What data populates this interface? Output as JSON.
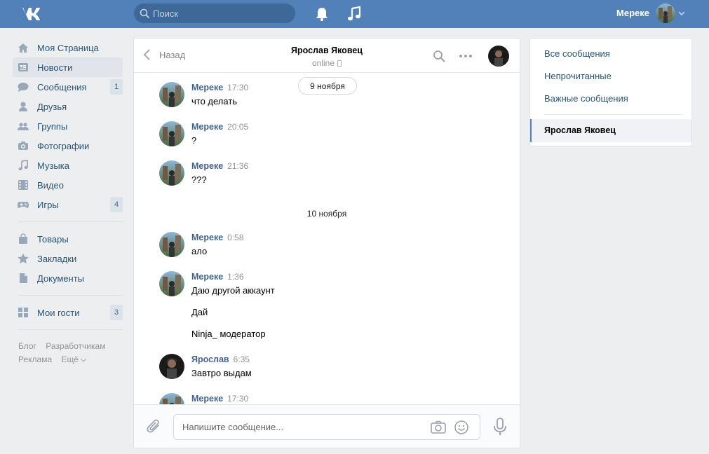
{
  "header": {
    "search_placeholder": "Поиск",
    "user_name": "Мереке"
  },
  "leftnav": {
    "items": [
      {
        "label": "Моя Страница",
        "icon": "home-icon"
      },
      {
        "label": "Новости",
        "icon": "news-icon"
      },
      {
        "label": "Сообщения",
        "icon": "chat-icon",
        "badge": "1"
      },
      {
        "label": "Друзья",
        "icon": "person-icon"
      },
      {
        "label": "Группы",
        "icon": "group-icon"
      },
      {
        "label": "Фотографии",
        "icon": "camera-icon"
      },
      {
        "label": "Музыка",
        "icon": "music-note-icon"
      },
      {
        "label": "Видео",
        "icon": "film-icon"
      },
      {
        "label": "Игры",
        "icon": "gamepad-icon",
        "badge": "4"
      },
      {
        "label": "Товары",
        "icon": "bag-icon"
      },
      {
        "label": "Закладки",
        "icon": "star-icon"
      },
      {
        "label": "Документы",
        "icon": "document-icon"
      },
      {
        "label": "Мои гости",
        "icon": "grid-icon",
        "badge": "3"
      }
    ],
    "footer": {
      "blog": "Блог",
      "developers": "Разработчикам",
      "ads": "Реклама",
      "more": "Ещё"
    }
  },
  "chat": {
    "back_label": "Назад",
    "peer_name": "Ярослав Яковец",
    "peer_status": "online",
    "date_pill": "9 ноября",
    "date_sep": "10 ноября",
    "messages": [
      {
        "author": "Мереке",
        "time": "17:30",
        "lines": [
          "что делать"
        ]
      },
      {
        "author": "Мереке",
        "time": "20:05",
        "lines": [
          "?"
        ]
      },
      {
        "author": "Мереке",
        "time": "21:36",
        "lines": [
          "???"
        ]
      },
      {
        "author": "Мереке",
        "time": "0:58",
        "lines": [
          "ало"
        ]
      },
      {
        "author": "Мереке",
        "time": "1:36",
        "lines": [
          "Даю другой аккаунт",
          "Дай",
          "Ninja_ модератор"
        ]
      },
      {
        "author": "Ярослав",
        "time": "6:35",
        "lines": [
          "Завтро выдам"
        ]
      },
      {
        "author": "Мереке",
        "time": "17:30",
        "lines": []
      }
    ],
    "composer_placeholder": "Напишите сообщение..."
  },
  "rpanel": {
    "all": "Все сообщения",
    "unread": "Непрочитанные",
    "important": "Важные сообщения",
    "active": "Ярослав Яковец"
  },
  "colors": {
    "header_bg": "#5181b8",
    "link": "#285473",
    "author": "#42648b",
    "page_bg": "#edeef0"
  }
}
